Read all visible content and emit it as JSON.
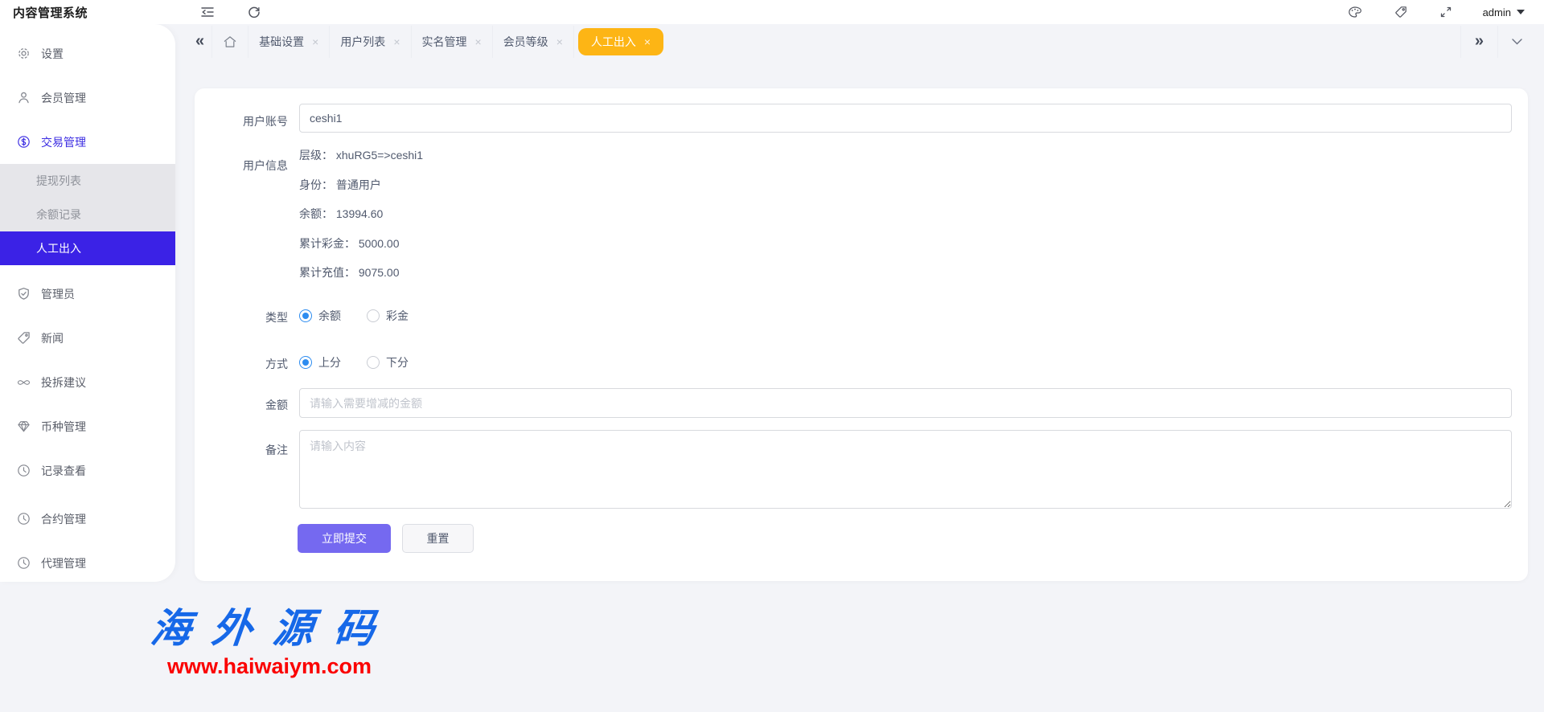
{
  "app": {
    "title": "内容管理系统"
  },
  "topbar": {
    "icons": [
      "menu-fold-icon",
      "refresh-icon",
      "palette-icon",
      "tag-icon",
      "fullscreen-icon"
    ],
    "user": {
      "name": "admin"
    }
  },
  "tabbar": {
    "tabs": [
      {
        "label": "基础设置",
        "active": false
      },
      {
        "label": "用户列表",
        "active": false
      },
      {
        "label": "实名管理",
        "active": false
      },
      {
        "label": "会员等级",
        "active": false
      },
      {
        "label": "人工出入",
        "active": true
      }
    ]
  },
  "sidebar": {
    "items_top": [
      {
        "label": "设置",
        "icon": "gear-icon",
        "active": false
      },
      {
        "label": "会员管理",
        "icon": "user-icon",
        "active": false
      },
      {
        "label": "交易管理",
        "icon": "dollar-circle-icon",
        "active": true
      }
    ],
    "submenu": [
      {
        "label": "提现列表",
        "active": false
      },
      {
        "label": "余额记录",
        "active": false
      },
      {
        "label": "人工出入",
        "active": true
      }
    ],
    "items_bottom": [
      {
        "label": "管理员",
        "icon": "shield-check-icon"
      },
      {
        "label": "新闻",
        "icon": "tag-icon"
      },
      {
        "label": "投拆建议",
        "icon": "infinity-icon"
      },
      {
        "label": "币种管理",
        "icon": "gem-icon"
      },
      {
        "label": "记录查看",
        "icon": "clock-circle-icon"
      },
      {
        "label": "合约管理",
        "icon": "clock-circle-icon"
      },
      {
        "label": "代理管理",
        "icon": "clock-circle-icon"
      }
    ]
  },
  "form": {
    "account": {
      "label": "用户账号",
      "value": "ceshi1"
    },
    "user_info": {
      "label": "用户信息",
      "lines": [
        "层级： xhuRG5=>ceshi1",
        "身份： 普通用户",
        "余额： 13994.60",
        "累计彩金： 5000.00",
        "累计充值： 9075.00"
      ]
    },
    "type": {
      "label": "类型",
      "options": [
        {
          "label": "余额",
          "selected": true
        },
        {
          "label": "彩金",
          "selected": false
        }
      ]
    },
    "method": {
      "label": "方式",
      "options": [
        {
          "label": "上分",
          "selected": true
        },
        {
          "label": "下分",
          "selected": false
        }
      ]
    },
    "amount": {
      "label": "金额",
      "placeholder": "请输入需要增减的金额"
    },
    "remark": {
      "label": "备注",
      "placeholder": "请输入内容"
    },
    "submit_label": "立即提交",
    "reset_label": "重置"
  },
  "watermark": {
    "brand": "海外源码",
    "url": "www.haiwaiym.com"
  },
  "colors": {
    "sidebar_active_bg": "#3b22e6",
    "menu_active_text": "#3c2de2",
    "tab_active_bg": "#fdb515",
    "submit_bg": "#7569f0",
    "radio_selected": "#2d8cf0",
    "watermark_blue": "#1668e8",
    "watermark_red": "#fb0000"
  }
}
